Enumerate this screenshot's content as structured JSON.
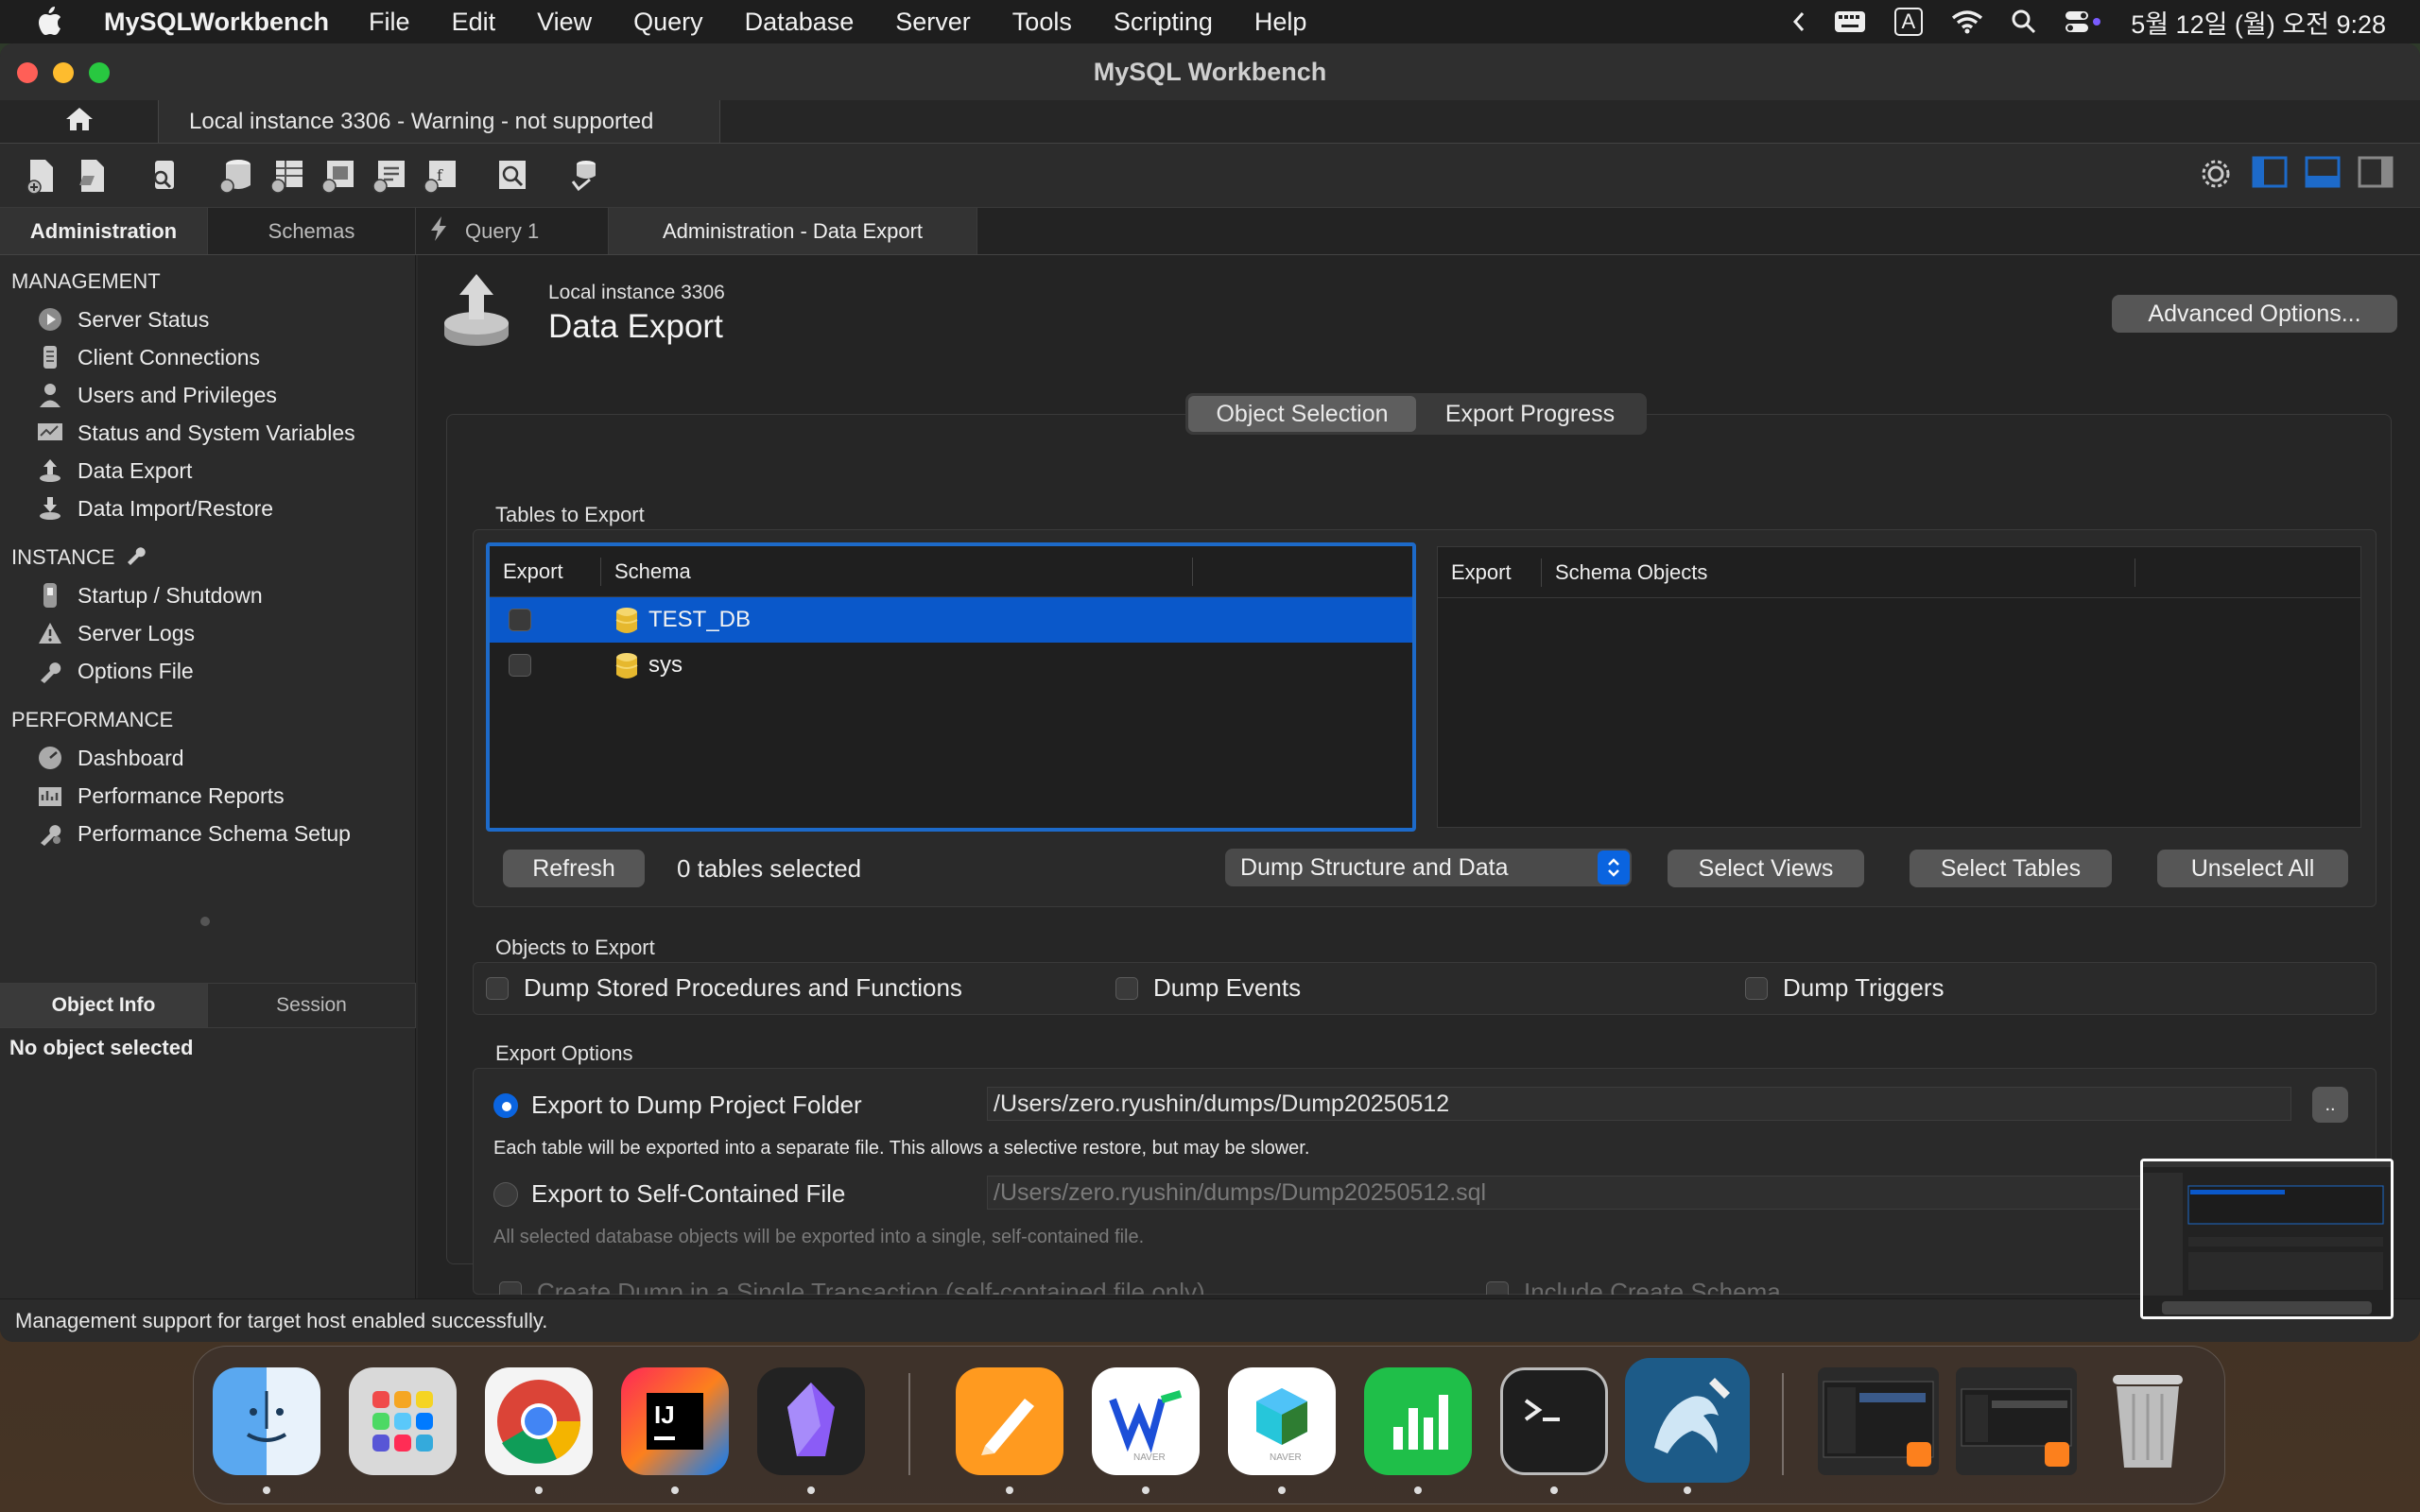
{
  "menubar": {
    "app_name": "MySQLWorkbench",
    "items": [
      "File",
      "Edit",
      "View",
      "Query",
      "Database",
      "Server",
      "Tools",
      "Scripting",
      "Help"
    ],
    "input_indicator": "A",
    "datetime": "5월 12일 (월) 오전 9:28"
  },
  "window": {
    "title": "MySQL Workbench",
    "connection_tab": "Local instance 3306 - Warning - not supported"
  },
  "sub_tabs": {
    "administration": "Administration",
    "schemas": "Schemas",
    "query": "Query 1",
    "data_export": "Administration - Data Export"
  },
  "sidebar": {
    "management_title": "MANAGEMENT",
    "management": [
      "Server Status",
      "Client Connections",
      "Users and Privileges",
      "Status and System Variables",
      "Data Export",
      "Data Import/Restore"
    ],
    "instance_title": "INSTANCE",
    "instance": [
      "Startup / Shutdown",
      "Server Logs",
      "Options File"
    ],
    "performance_title": "PERFORMANCE",
    "performance": [
      "Dashboard",
      "Performance Reports",
      "Performance Schema Setup"
    ],
    "object_info_tab": "Object Info",
    "session_tab": "Session",
    "no_object": "No object selected"
  },
  "header": {
    "instance": "Local instance 3306",
    "title": "Data Export",
    "advanced_button": "Advanced Options..."
  },
  "segments": {
    "object_selection": "Object Selection",
    "export_progress": "Export Progress"
  },
  "tables_to_export": {
    "label": "Tables to Export",
    "left_headers": {
      "export": "Export",
      "schema": "Schema"
    },
    "right_headers": {
      "export": "Export",
      "schema_objects": "Schema Objects"
    },
    "schemas": [
      {
        "name": "TEST_DB",
        "checked": false,
        "selected": true
      },
      {
        "name": "sys",
        "checked": false,
        "selected": false
      }
    ],
    "refresh_button": "Refresh",
    "tables_selected": "0 tables selected",
    "dump_mode": "Dump Structure and Data",
    "select_views": "Select Views",
    "select_tables": "Select Tables",
    "unselect_all": "Unselect All"
  },
  "objects_to_export": {
    "label": "Objects to Export",
    "procedures": "Dump Stored Procedures and Functions",
    "events": "Dump Events",
    "triggers": "Dump Triggers"
  },
  "export_options": {
    "label": "Export Options",
    "folder_option": "Export to Dump Project Folder",
    "folder_path": "/Users/zero.ryushin/dumps/Dump20250512",
    "browse_button": "..",
    "folder_note": "Each table will be exported into a separate file. This allows a selective restore, but may be slower.",
    "file_option": "Export to Self-Contained File",
    "file_path": "/Users/zero.ryushin/dumps/Dump20250512.sql",
    "file_note": "All selected database objects will be exported into a single, self-contained file.",
    "single_transaction": "Create Dump in a Single Transaction (self-contained file only)",
    "include_schema": "Include Create Schema"
  },
  "statusbar": {
    "message": "Management support for target host enabled successfully."
  },
  "colors": {
    "accent": "#0a58ca",
    "focus_ring": "#1d6ac9",
    "panel_bg": "#242424"
  }
}
